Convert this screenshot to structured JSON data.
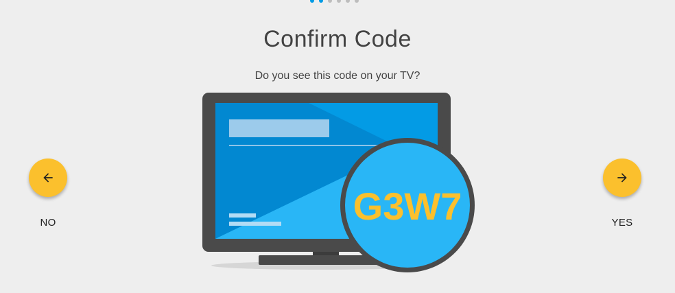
{
  "progress": {
    "total_steps": 6,
    "active_steps": 2,
    "active_color": "#039be5",
    "inactive_color": "#bdbdbd"
  },
  "header": {
    "title": "Confirm Code"
  },
  "prompt": {
    "text": "Do you see this code on your TV?"
  },
  "code": {
    "value": "G3W7"
  },
  "actions": {
    "no_label": "NO",
    "no_icon": "arrow-left-icon",
    "yes_label": "YES",
    "yes_icon": "arrow-right-icon"
  },
  "colors": {
    "background": "#eeeeee",
    "button": "#fbc02d",
    "screen_blue": "#039be5",
    "code_badge": "#29b6f6",
    "code_text": "#fbc02d",
    "frame": "#4a4a4a"
  }
}
